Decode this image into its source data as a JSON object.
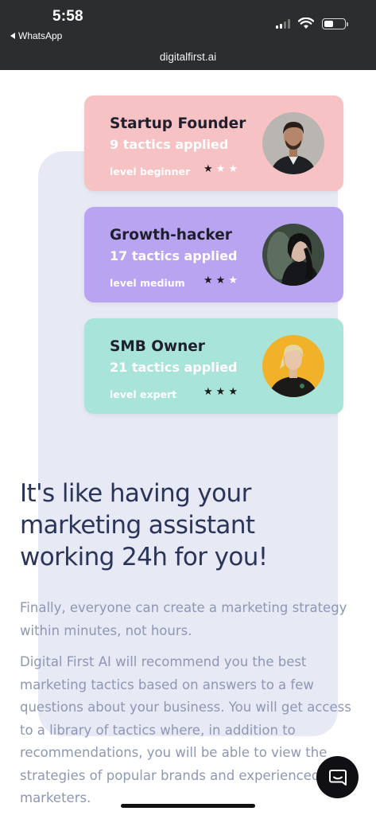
{
  "status_bar": {
    "time": "5:58",
    "back_app": "WhatsApp"
  },
  "browser": {
    "url": "digitalfirst.ai"
  },
  "cards": [
    {
      "title": "Startup Founder",
      "tactics": "9 tactics applied",
      "level": "level beginner",
      "stars_filled": 1,
      "stars_total": 3,
      "color": "#f7c2c4"
    },
    {
      "title": "Growth-hacker",
      "tactics": "17 tactics applied",
      "level": "level medium",
      "stars_filled": 2,
      "stars_total": 3,
      "color": "#b9a4f1"
    },
    {
      "title": "SMB Owner",
      "tactics": "21 tactics applied",
      "level": "level expert",
      "stars_filled": 3,
      "stars_total": 3,
      "color": "#a9e4da"
    }
  ],
  "hero": {
    "headline": "It's like having your marketing assistant working 24h for you!"
  },
  "body": {
    "paragraph1": "Finally, everyone can create a marketing strategy within minutes, not hours.",
    "paragraph2": "Digital First AI will recommend you the best marketing tactics based on answers to a few questions about your business. You will get access to a library of tactics where, in addition to recommendations, you will be able to view the strategies of popular brands and experienced marketers."
  },
  "icons": {
    "chat": "chat-bubble-icon",
    "back": "back-arrow-icon",
    "signal": "cellular-signal-icon",
    "wifi": "wifi-icon",
    "battery": "battery-icon"
  },
  "colors": {
    "heading": "#2a3559",
    "body_text": "#8e97b3",
    "panel": "#e7e9f5"
  }
}
